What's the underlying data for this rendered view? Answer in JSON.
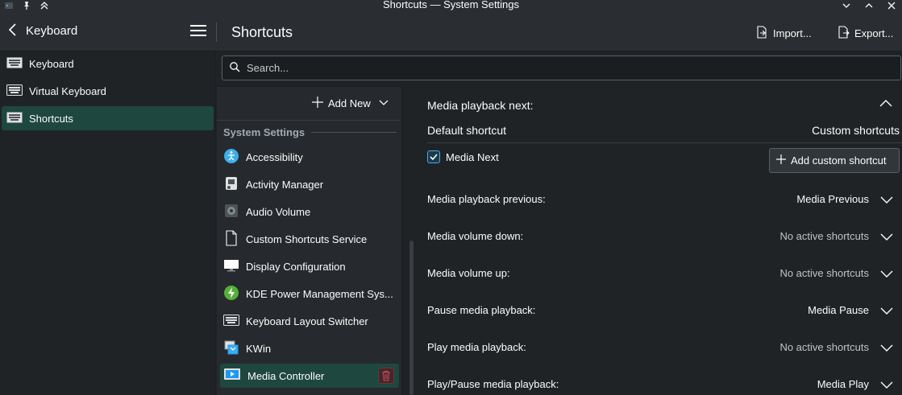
{
  "window": {
    "title": "Shortcuts — System Settings"
  },
  "header": {
    "back_label": "Keyboard",
    "page_title": "Shortcuts",
    "import_label": "Import...",
    "export_label": "Export..."
  },
  "sidebar": {
    "items": [
      {
        "label": "Keyboard"
      },
      {
        "label": "Virtual Keyboard"
      },
      {
        "label": "Shortcuts"
      }
    ]
  },
  "search": {
    "placeholder": "Search..."
  },
  "categories": {
    "add_new_label": "Add New",
    "group_header": "System Settings",
    "items": [
      {
        "label": "Accessibility",
        "icon": "accessibility-icon"
      },
      {
        "label": "Activity Manager",
        "icon": "activity-manager-icon"
      },
      {
        "label": "Audio Volume",
        "icon": "audio-volume-icon"
      },
      {
        "label": "Custom Shortcuts Service",
        "icon": "document-icon"
      },
      {
        "label": "Display Configuration",
        "icon": "display-icon"
      },
      {
        "label": "KDE Power Management Sys...",
        "icon": "power-icon"
      },
      {
        "label": "Keyboard Layout Switcher",
        "icon": "keyboard-icon"
      },
      {
        "label": "KWin",
        "icon": "kwin-icon"
      },
      {
        "label": "Media Controller",
        "icon": "media-controller-icon"
      }
    ]
  },
  "shortcuts": {
    "expanded_title": "Media playback next:",
    "default_col": "Default shortcut",
    "custom_col": "Custom shortcuts",
    "default_value": "Media Next",
    "add_custom_label": "Add custom shortcut",
    "actions": [
      {
        "name": "Media playback previous:",
        "value": "Media Previous"
      },
      {
        "name": "Media volume down:",
        "value": "No active shortcuts"
      },
      {
        "name": "Media volume up:",
        "value": "No active shortcuts"
      },
      {
        "name": "Pause media playback:",
        "value": "Media Pause"
      },
      {
        "name": "Play media playback:",
        "value": "No active shortcuts"
      },
      {
        "name": "Play/Pause media playback:",
        "value": "Media Play"
      }
    ]
  },
  "colors": {
    "accent": "#3daee9",
    "selection": "#1e4740",
    "background": "#202326"
  }
}
